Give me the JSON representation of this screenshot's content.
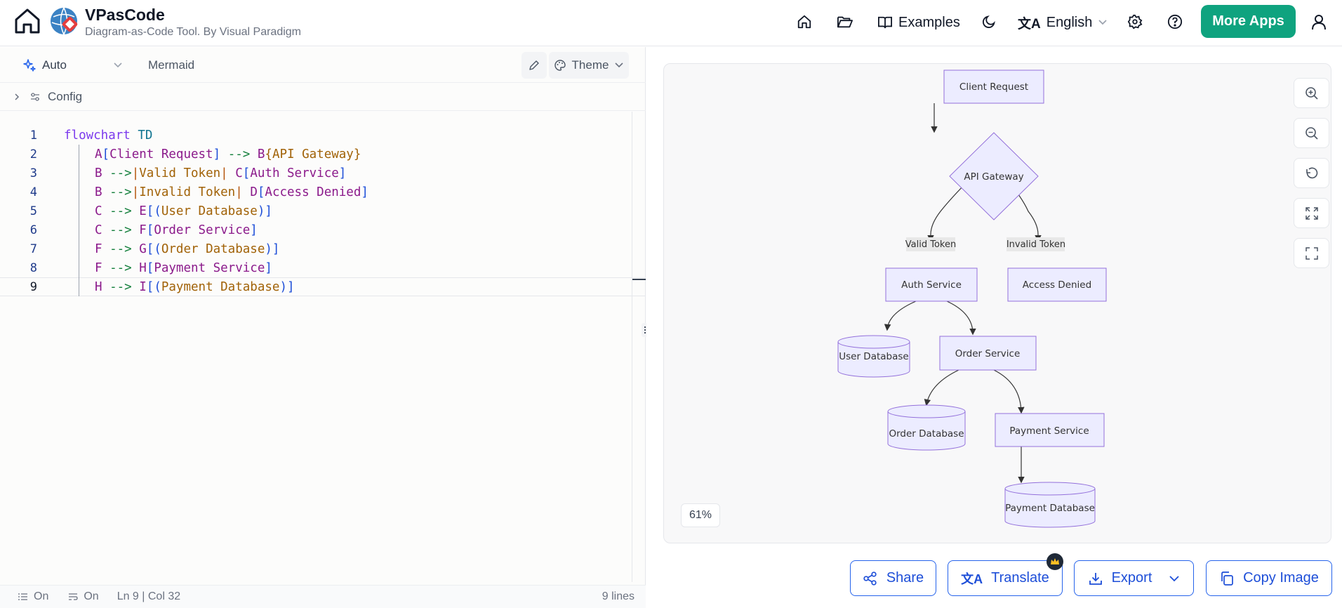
{
  "header": {
    "brand_title": "VPasCode",
    "brand_subtitle": "Diagram-as-Code Tool. By Visual Paradigm",
    "examples_label": "Examples",
    "language_label": "English",
    "more_apps_label": "More Apps"
  },
  "toolbar": {
    "mode_label": "Auto",
    "language_label": "Mermaid",
    "theme_label": "Theme"
  },
  "config": {
    "label": "Config"
  },
  "editor": {
    "lines": [
      {
        "num": "1",
        "t": [
          "flowchart",
          " ",
          "TD"
        ]
      },
      {
        "num": "2",
        "t": [
          "A",
          "[",
          "Client Request",
          "]",
          " --> ",
          "B",
          "{",
          "API Gateway",
          "}"
        ]
      },
      {
        "num": "3",
        "t": [
          "B",
          " -->",
          "|",
          "Valid Token",
          "|",
          " ",
          "C",
          "[",
          "Auth Service",
          "]"
        ]
      },
      {
        "num": "4",
        "t": [
          "B",
          " -->",
          "|",
          "Invalid Token",
          "|",
          " ",
          "D",
          "[",
          "Access Denied",
          "]"
        ]
      },
      {
        "num": "5",
        "t": [
          "C",
          " --> ",
          "E",
          "[(",
          "User Database",
          ")]"
        ]
      },
      {
        "num": "6",
        "t": [
          "C",
          " --> ",
          "F",
          "[",
          "Order Service",
          "]"
        ]
      },
      {
        "num": "7",
        "t": [
          "F",
          " --> ",
          "G",
          "[(",
          "Order Database",
          ")]"
        ]
      },
      {
        "num": "8",
        "t": [
          "F",
          " --> ",
          "H",
          "[",
          "Payment Service",
          "]"
        ]
      },
      {
        "num": "9",
        "t": [
          "H",
          " --> ",
          "I",
          "[(",
          "Payment Database",
          ")]"
        ]
      }
    ]
  },
  "status": {
    "lines_toggle": "On",
    "wrap_toggle": "On",
    "position": "Ln 9 | Col 32",
    "line_count": "9 lines"
  },
  "diagram": {
    "nodes": {
      "client_request": "Client Request",
      "api_gateway": "API Gateway",
      "auth_service": "Auth Service",
      "access_denied": "Access Denied",
      "user_database": "User Database",
      "order_service": "Order Service",
      "order_database": "Order Database",
      "payment_service": "Payment Service",
      "payment_database": "Payment Database"
    },
    "edge_labels": {
      "valid_token": "Valid Token",
      "invalid_token": "Invalid Token"
    },
    "zoom_level": "61%"
  },
  "actions": {
    "share_label": "Share",
    "translate_label": "Translate",
    "export_label": "Export",
    "copy_image_label": "Copy Image"
  },
  "colors": {
    "accent": "#0fa37f",
    "node_fill": "#ececff",
    "node_stroke": "#9370db",
    "action_blue": "#1d4ed8"
  }
}
